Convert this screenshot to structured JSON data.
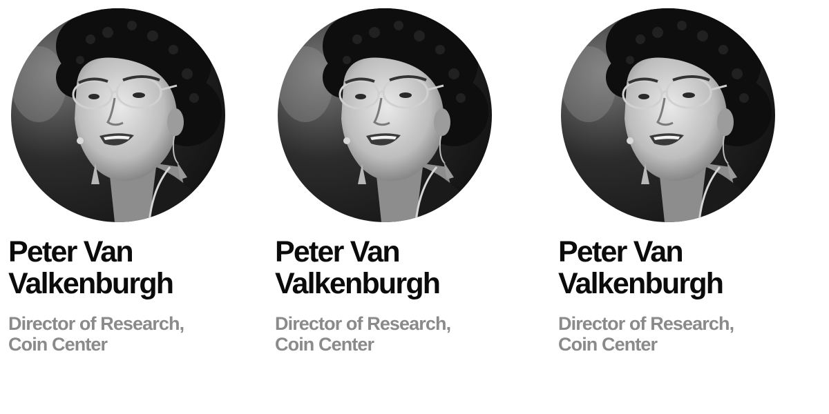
{
  "speakers": [
    {
      "name_line1": "Peter Van",
      "name_line2": "Valkenburgh",
      "title_line1": "Director of Research,",
      "title_line2": "Coin Center"
    },
    {
      "name_line1": "Peter Van",
      "name_line2": "Valkenburgh",
      "title_line1": "Director of Research,",
      "title_line2": "Coin Center"
    },
    {
      "name_line1": "Peter Van",
      "name_line2": "Valkenburgh",
      "title_line1": "Director of Research,",
      "title_line2": "Coin Center"
    }
  ],
  "colors": {
    "name": "#0b0b0b",
    "title": "#8a8a8a",
    "background": "#ffffff"
  }
}
